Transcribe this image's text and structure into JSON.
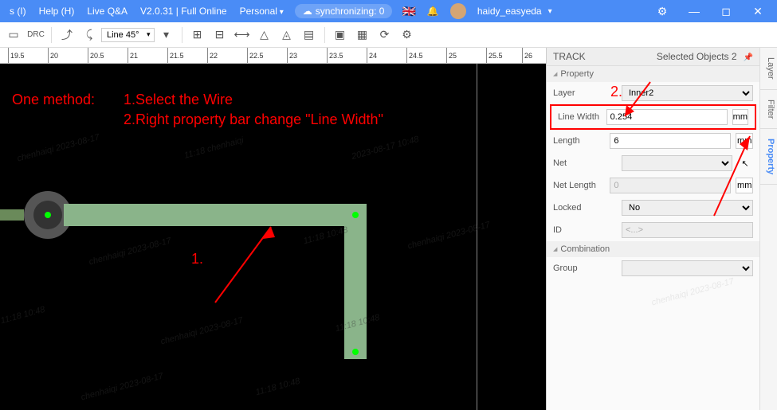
{
  "titlebar": {
    "menu1": "s (I)",
    "help": "Help (H)",
    "qa": "Live Q&A",
    "version": "V2.0.31 | Full Online",
    "account": "Personal",
    "sync": "synchronizing: 0",
    "username": "haidy_easyeda"
  },
  "toolbar": {
    "drc": "DRC",
    "line_angle": "Line 45°"
  },
  "ruler": {
    "ticks": [
      "19.5",
      "20",
      "20.5",
      "21",
      "21.5",
      "22",
      "22.5",
      "23",
      "23.5",
      "24",
      "24.5",
      "25",
      "25.5",
      "26"
    ]
  },
  "annotations": {
    "title": "One method:",
    "step1": "1.Select the Wire",
    "step2": "2.Right property bar change \"Line Width\"",
    "num1": "1.",
    "num2": "2."
  },
  "panel": {
    "title": "TRACK",
    "subtitle": "Selected Objects 2",
    "section_property": "Property",
    "section_combination": "Combination",
    "layer_label": "Layer",
    "layer_value": "Inner2",
    "linewidth_label": "Line Width",
    "linewidth_value": "0.254",
    "length_label": "Length",
    "length_value": "6",
    "net_label": "Net",
    "net_value": "",
    "netlength_label": "Net Length",
    "netlength_value": "0",
    "locked_label": "Locked",
    "locked_value": "No",
    "id_label": "ID",
    "id_value": "<...>",
    "group_label": "Group",
    "unit_mm": "mm"
  },
  "tabs": {
    "layer": "Layer",
    "filter": "Filter",
    "property": "Property"
  }
}
